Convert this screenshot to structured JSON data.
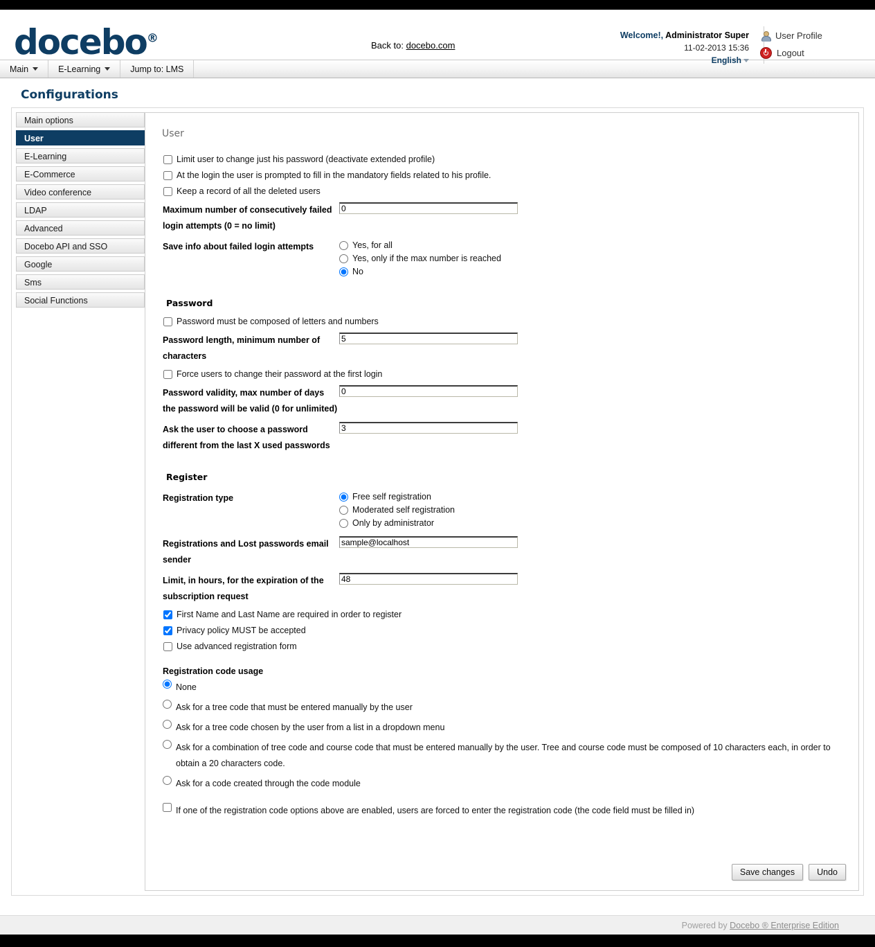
{
  "header": {
    "logo_text": "docebo",
    "logo_reg": "®",
    "back_to_label": "Back to:",
    "back_to_link": "docebo.com",
    "welcome_prefix": "Welcome!,",
    "welcome_user": "Administrator Super",
    "datetime": "11-02-2013 15:36",
    "language": "English",
    "user_profile_label": "User Profile",
    "logout_label": "Logout"
  },
  "menubar": {
    "items": [
      {
        "label": "Main",
        "has_caret": true
      },
      {
        "label": "E-Learning",
        "has_caret": true
      },
      {
        "label": "Jump to: LMS",
        "has_caret": false
      }
    ]
  },
  "page": {
    "title": "Configurations"
  },
  "sidebar": {
    "items": [
      {
        "label": "Main options",
        "active": false
      },
      {
        "label": "User",
        "active": true
      },
      {
        "label": "E-Learning",
        "active": false
      },
      {
        "label": "E-Commerce",
        "active": false
      },
      {
        "label": "Video conference",
        "active": false
      },
      {
        "label": "LDAP",
        "active": false
      },
      {
        "label": "Advanced",
        "active": false
      },
      {
        "label": "Docebo API and SSO",
        "active": false
      },
      {
        "label": "Google",
        "active": false
      },
      {
        "label": "Sms",
        "active": false
      },
      {
        "label": "Social Functions",
        "active": false
      }
    ]
  },
  "panel": {
    "title": "User",
    "checkboxes_top": [
      {
        "label": "Limit user to change just his password (deactivate extended profile)",
        "checked": false
      },
      {
        "label": "At the login the user is prompted to fill in the mandatory fields related to his profile.",
        "checked": false
      },
      {
        "label": "Keep a record of all the deleted users",
        "checked": false
      }
    ],
    "max_failed_login": {
      "label": "Maximum number of consecutively failed login attempts (0 = no limit)",
      "value": "0"
    },
    "save_failed_info": {
      "label": "Save info about failed login attempts",
      "options": [
        {
          "label": "Yes, for all",
          "selected": false
        },
        {
          "label": "Yes, only if the max number is reached",
          "selected": false
        },
        {
          "label": "No",
          "selected": true
        }
      ]
    },
    "password_section": {
      "heading": "Password",
      "letters_numbers": {
        "label": "Password must be composed of letters and numbers",
        "checked": false
      },
      "min_length": {
        "label": "Password length, minimum number of characters",
        "value": "5"
      },
      "force_change": {
        "label": "Force users to change their password at the first login",
        "checked": false
      },
      "validity_days": {
        "label": "Password validity, max number of days the password will be valid (0 for unlimited)",
        "value": "0"
      },
      "last_x_passwords": {
        "label": "Ask the user to choose a password different from the last X used passwords",
        "value": "3"
      }
    },
    "register_section": {
      "heading": "Register",
      "registration_type": {
        "label": "Registration type",
        "options": [
          {
            "label": "Free self registration",
            "selected": true
          },
          {
            "label": "Moderated self registration",
            "selected": false
          },
          {
            "label": "Only by administrator",
            "selected": false
          }
        ]
      },
      "email_sender": {
        "label": "Registrations and Lost passwords email sender",
        "value": "sample@localhost"
      },
      "expiration_limit": {
        "label": "Limit, in hours, for the expiration of the subscription request",
        "value": "48"
      },
      "checkboxes": [
        {
          "label": "First Name and Last Name are required in order to register",
          "checked": true
        },
        {
          "label": "Privacy policy MUST be accepted",
          "checked": true
        },
        {
          "label": "Use advanced registration form",
          "checked": false
        }
      ],
      "registration_code_usage": {
        "heading": "Registration code usage",
        "options": [
          {
            "label": "None",
            "selected": true
          },
          {
            "label": "Ask for a tree code that must be entered manually by the user",
            "selected": false
          },
          {
            "label": "Ask for a tree code chosen by the user from a list in a dropdown menu",
            "selected": false
          },
          {
            "label": "Ask for a combination of tree code and course code that must be entered manually by the user. Tree and course code must be composed of 10 characters each, in order to obtain a 20 characters code.",
            "selected": false
          },
          {
            "label": "Ask for a code created through the code module",
            "selected": false
          }
        ],
        "force_checkbox": {
          "label": "If one of the registration code options above are enabled, users are forced to enter the registration code (the code field must be filled in)",
          "checked": false
        }
      }
    },
    "buttons": {
      "save_label": "Save changes",
      "undo_label": "Undo"
    }
  },
  "footer": {
    "powered_prefix": "Powered by ",
    "powered_link": "Docebo ® Enterprise Edition"
  },
  "colors": {
    "brand_navy": "#0e3d63",
    "sidebar_active_bg": "#0e3d63",
    "logout_red": "#cf2222"
  }
}
